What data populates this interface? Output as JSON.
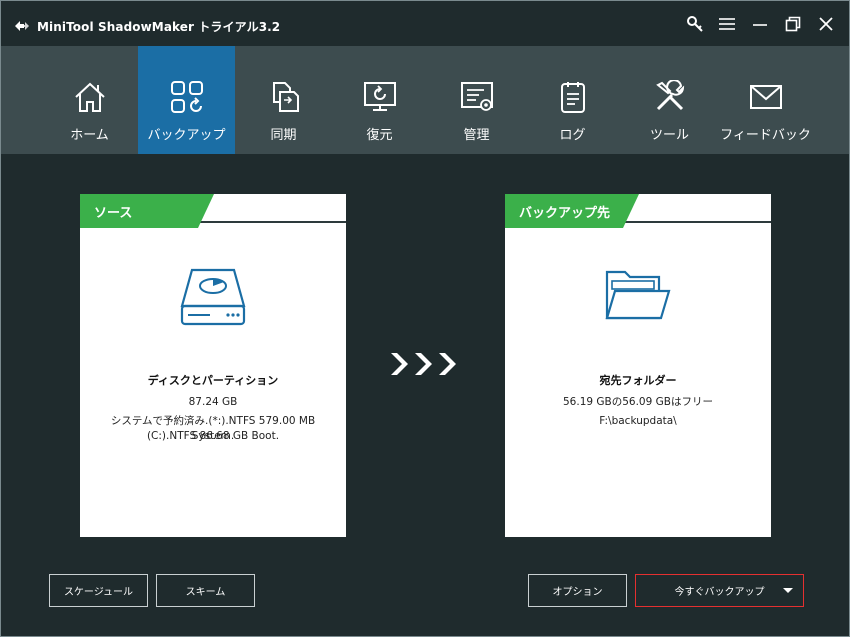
{
  "app": {
    "title": "MiniTool ShadowMaker トライアル3.2"
  },
  "titlebar": {
    "buttons": [
      "key-icon",
      "menu-icon",
      "minimize-icon",
      "restore-icon",
      "close-icon"
    ]
  },
  "nav": {
    "items": [
      {
        "label": "ホーム",
        "icon": "home-icon"
      },
      {
        "label": "バックアップ",
        "icon": "backup-icon",
        "active": true
      },
      {
        "label": "同期",
        "icon": "sync-icon"
      },
      {
        "label": "復元",
        "icon": "restore-icon"
      },
      {
        "label": "管理",
        "icon": "manage-icon"
      },
      {
        "label": "ログ",
        "icon": "log-icon"
      },
      {
        "label": "ツール",
        "icon": "tools-icon"
      },
      {
        "label": "フィードバック",
        "icon": "feedback-icon"
      }
    ]
  },
  "source": {
    "tab_label": "ソース",
    "title": "ディスクとパーティション",
    "size": "87.24 GB",
    "detail_line1": "システムで予約済み.(*:).NTFS 579.00 MB System.",
    "detail_line2": "(C:).NTFS 86.68 GB Boot."
  },
  "destination": {
    "tab_label": "バックアップ先",
    "title": "宛先フォルダー",
    "space": "56.19 GBの56.09 GBはフリー",
    "path": "F:\\backupdata\\"
  },
  "buttons": {
    "schedule": "スケージュール",
    "scheme": "スキーム",
    "options": "オプション",
    "backup_now": "今すぐバックアップ"
  },
  "colors": {
    "accent_blue": "#1b6ea5",
    "tab_green": "#3bb04a",
    "primary_border": "#e53030"
  }
}
